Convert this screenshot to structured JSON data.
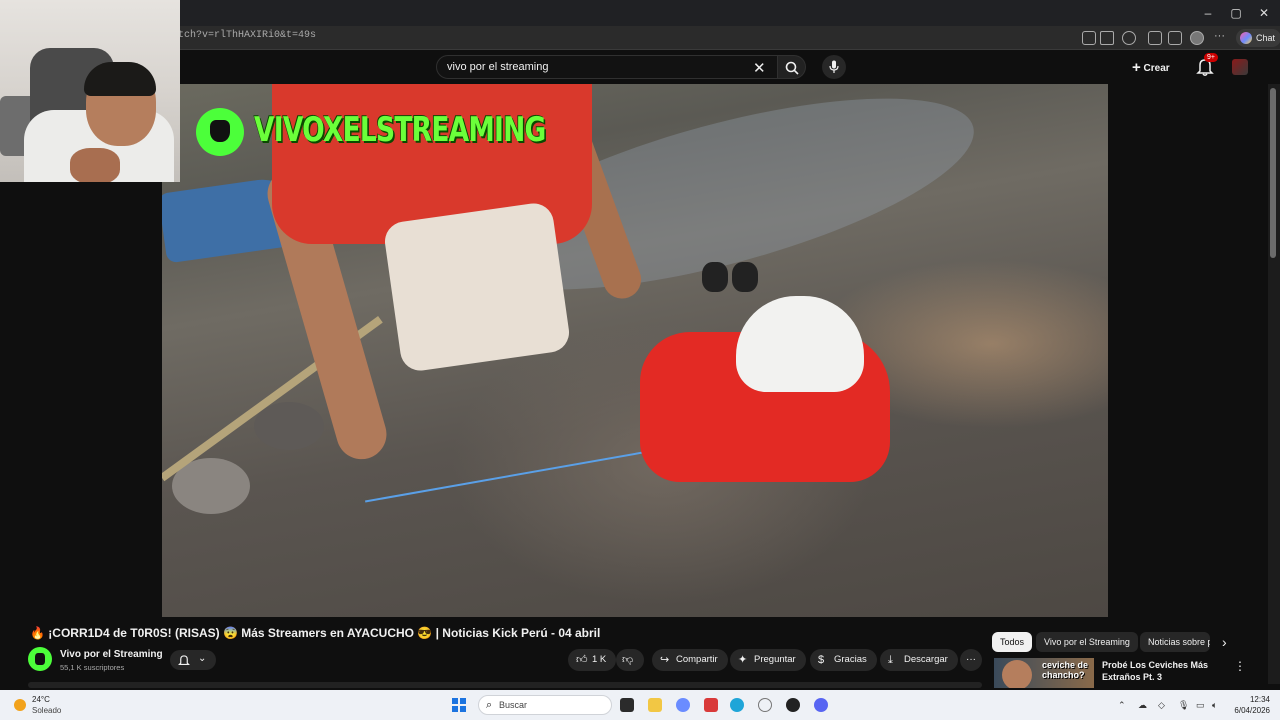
{
  "browser": {
    "url": "tch?v=rlThHAXIRi0&t=49s",
    "chat_label": "Chat",
    "window_controls": [
      "minimize-icon",
      "maximize-icon",
      "close-icon"
    ]
  },
  "youtube": {
    "search": {
      "value": "vivo por el streaming"
    },
    "create_label": "Crear",
    "notification_count": "9+"
  },
  "video": {
    "watermark_text": "VIVOXELSTREAMING",
    "title": "🔥 ¡CORR1D4 de T0R0S! (RISAS) 😨 Más Streamers en AYACUCHO 😎 | Noticias Kick Perú - 04 abril",
    "channel_name": "Vivo por el Streaming",
    "subscribers": "55,1 K suscriptores",
    "actions": {
      "like_count": "1 K",
      "share": "Compartir",
      "ask": "Preguntar",
      "thanks": "Gracias",
      "download": "Descargar"
    }
  },
  "sidebar": {
    "chips": [
      "Todos",
      "Vivo por el Streaming",
      "Noticias sobre p"
    ],
    "recommendation": {
      "thumb_text": "ceviche de chancho?",
      "title": "Probé Los Ceviches Más Extraños Pt. 3"
    }
  },
  "taskbar": {
    "weather_temp": "24°C",
    "weather_desc": "Soleado",
    "search_placeholder": "Buscar",
    "time": "12:34",
    "date": "6/04/2026"
  },
  "colors": {
    "brand_green": "#4cff3a",
    "youtube_bg": "#0f0f0f",
    "notification_red": "#cc0000"
  }
}
